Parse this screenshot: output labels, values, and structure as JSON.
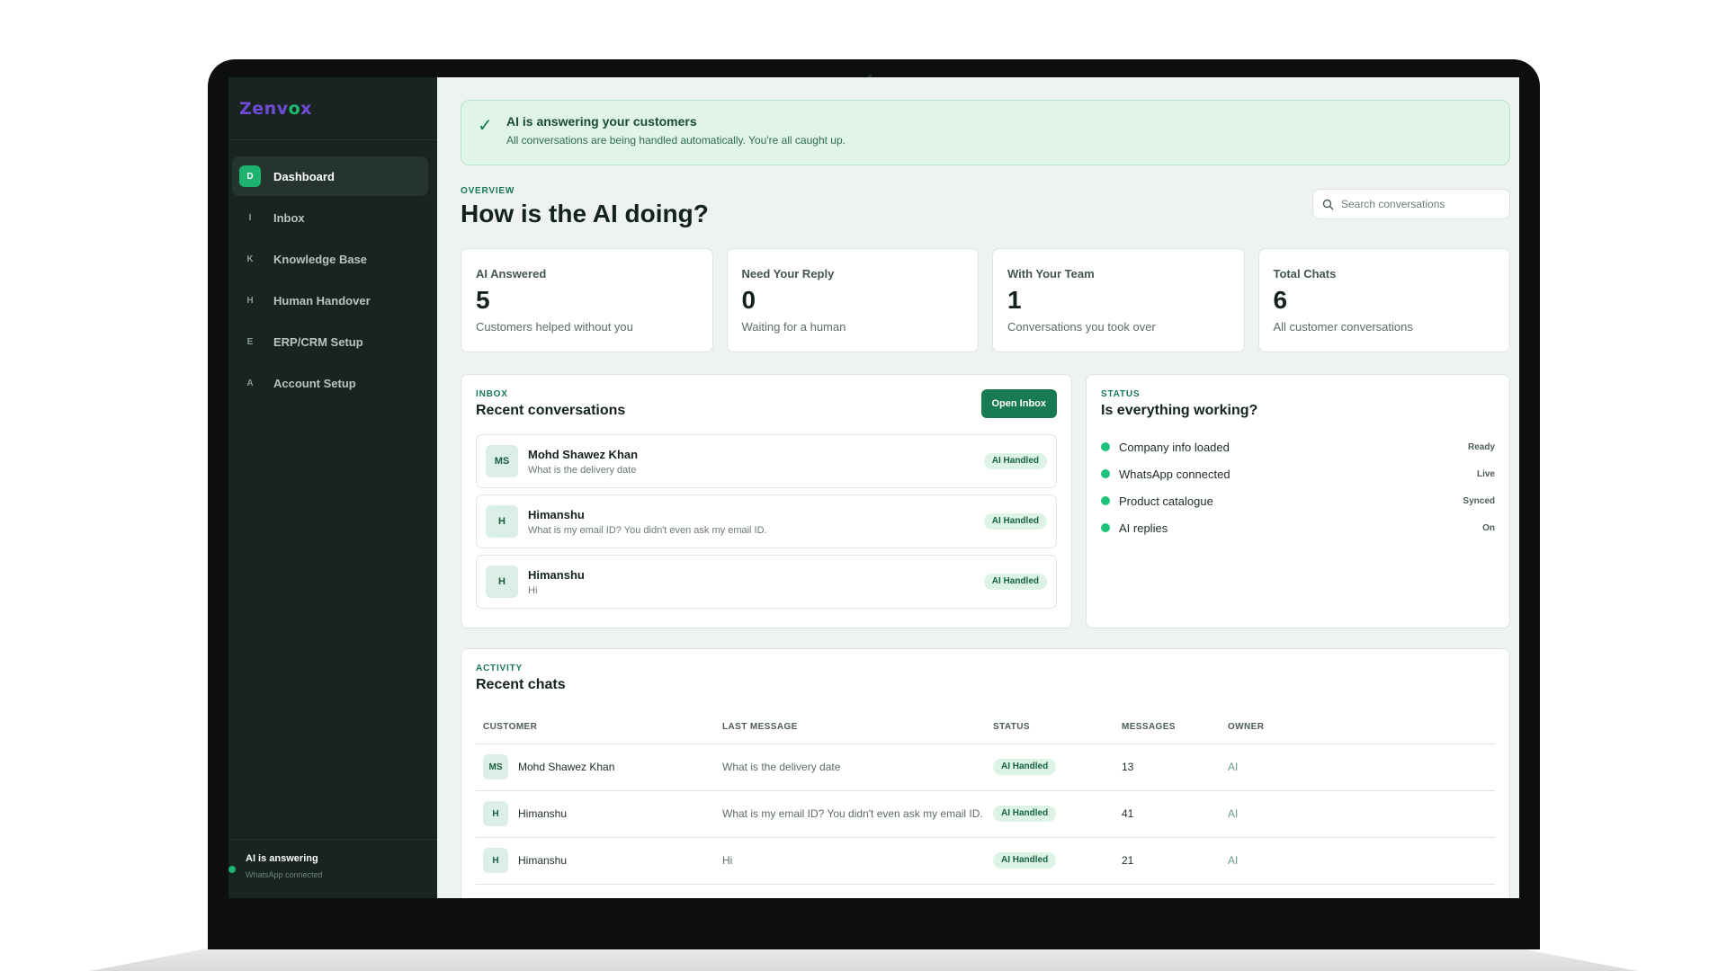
{
  "brand": {
    "name_part1": "Zenv",
    "name_mark": "o",
    "name_part2": "x"
  },
  "sidebar": {
    "items": [
      {
        "badge": "D",
        "label": "Dashboard",
        "active": true
      },
      {
        "badge": "I",
        "label": "Inbox"
      },
      {
        "badge": "K",
        "label": "Knowledge Base"
      },
      {
        "badge": "H",
        "label": "Human Handover"
      },
      {
        "badge": "E",
        "label": "ERP/CRM Setup"
      },
      {
        "badge": "A",
        "label": "Account Setup"
      }
    ],
    "footer": {
      "title": "AI is answering",
      "subtitle": "WhatsApp connected"
    }
  },
  "banner": {
    "title": "AI is answering your customers",
    "subtitle": "All conversations are being handled automatically. You're all caught up."
  },
  "overview": {
    "eyebrow": "OVERVIEW",
    "title": "How is the AI doing?",
    "search_placeholder": "Search conversations"
  },
  "stats": [
    {
      "label": "AI Answered",
      "value": "5",
      "caption": "Customers helped without you"
    },
    {
      "label": "Need Your Reply",
      "value": "0",
      "caption": "Waiting for a human"
    },
    {
      "label": "With Your Team",
      "value": "1",
      "caption": "Conversations you took over"
    },
    {
      "label": "Total Chats",
      "value": "6",
      "caption": "All customer conversations"
    }
  ],
  "inbox": {
    "eyebrow": "INBOX",
    "title": "Recent conversations",
    "open_button": "Open Inbox",
    "conversations": [
      {
        "initials": "MS",
        "name": "Mohd Shawez Khan",
        "message": "What is the delivery date",
        "status": "AI Handled"
      },
      {
        "initials": "H",
        "name": "Himanshu",
        "message": "What is my email ID? You didn't even ask my email ID.",
        "status": "AI Handled"
      },
      {
        "initials": "H",
        "name": "Himanshu",
        "message": "Hi",
        "status": "AI Handled"
      }
    ]
  },
  "status": {
    "eyebrow": "STATUS",
    "title": "Is everything working?",
    "items": [
      {
        "label": "Company info loaded",
        "value": "Ready"
      },
      {
        "label": "WhatsApp connected",
        "value": "Live"
      },
      {
        "label": "Product catalogue",
        "value": "Synced"
      },
      {
        "label": "AI replies",
        "value": "On"
      }
    ]
  },
  "activity": {
    "eyebrow": "ACTIVITY",
    "title": "Recent chats",
    "columns": [
      "CUSTOMER",
      "LAST MESSAGE",
      "STATUS",
      "MESSAGES",
      "OWNER"
    ],
    "rows": [
      {
        "initials": "MS",
        "customer": "Mohd Shawez Khan",
        "last_message": "What is the delivery date",
        "status": "AI Handled",
        "messages": "13",
        "owner": "AI"
      },
      {
        "initials": "H",
        "customer": "Himanshu",
        "last_message": "What is my email ID? You didn't even ask my email ID.",
        "status": "AI Handled",
        "messages": "41",
        "owner": "AI"
      },
      {
        "initials": "H",
        "customer": "Himanshu",
        "last_message": "Hi",
        "status": "AI Handled",
        "messages": "21",
        "owner": "AI"
      }
    ]
  },
  "colors": {
    "accent": "#187a52",
    "sidebar": "#172420",
    "status_green": "#1fc07a"
  }
}
